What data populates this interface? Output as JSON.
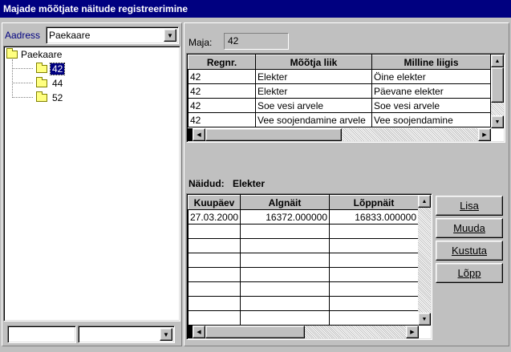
{
  "window": {
    "title": "Majade mõõtjate näitude registreerimine"
  },
  "address": {
    "label": "Aadress",
    "value": "Paekaare"
  },
  "tree": {
    "root": "Paekaare",
    "children": [
      "42",
      "44",
      "52"
    ]
  },
  "maja": {
    "label": "Maja:",
    "value": "42"
  },
  "meters": {
    "columns": [
      "Regnr.",
      "Mõõtja liik",
      "Milline liigis"
    ],
    "rows": [
      [
        "42",
        "Elekter",
        "Öine elekter"
      ],
      [
        "42",
        "Elekter",
        "Päevane elekter"
      ],
      [
        "42",
        "Soe vesi arvele",
        "Soe vesi arvele"
      ],
      [
        "42",
        "Vee soojendamine arvele",
        "Vee soojendamine"
      ]
    ]
  },
  "readings": {
    "label": "Näidud:",
    "meter": "Elekter",
    "columns": [
      "Kuupäev",
      "Algnäit",
      "Lõppnäit"
    ],
    "rows": [
      [
        "27.03.2000",
        "16372.000000",
        "16833.000000"
      ]
    ]
  },
  "buttons": {
    "add": "Lisa",
    "edit": "Muuda",
    "delete": "Kustuta",
    "close": "Lõpp"
  }
}
